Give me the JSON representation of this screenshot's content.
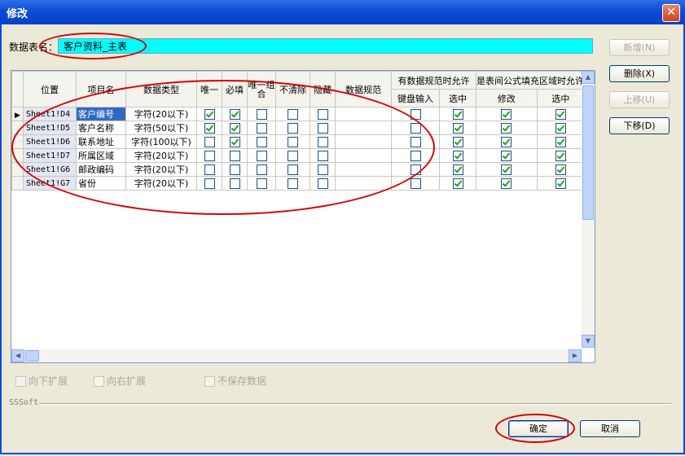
{
  "window": {
    "title": "修改",
    "close_icon": "close-icon"
  },
  "form": {
    "table_name_label": "数据表名：",
    "table_name_value": "客户资料_主表"
  },
  "buttons": {
    "add": "新增(N)",
    "delete": "删除(X)",
    "move_up": "上移(U)",
    "move_down": "下移(D)",
    "ok": "确定",
    "cancel": "取消"
  },
  "grid": {
    "headers": {
      "position": "位置",
      "item_name": "项目名",
      "data_type": "数据类型",
      "unique": "唯一",
      "required": "必填",
      "unique_combo": "唯一组合",
      "no_clear": "不清除",
      "hidden": "隐藏",
      "data_spec": "数据规范",
      "group1": "有数据规范时允许",
      "group2": "是表间公式填充区域时允许",
      "keyboard_input": "键盘输入",
      "select1": "选中",
      "modify": "修改",
      "select2": "选中"
    },
    "rows": [
      {
        "position": "Sheet1!D4",
        "name": "客户编号",
        "type": "字符(20以下)",
        "checks": [
          true,
          true,
          false,
          false,
          false,
          false,
          true,
          true,
          true
        ]
      },
      {
        "position": "Sheet1!D5",
        "name": "客户名称",
        "type": "字符(50以下)",
        "checks": [
          true,
          true,
          false,
          false,
          false,
          false,
          true,
          true,
          true
        ]
      },
      {
        "position": "Sheet1!D6",
        "name": "联系地址",
        "type": "字符(100以下)",
        "checks": [
          false,
          true,
          false,
          false,
          false,
          false,
          true,
          true,
          true
        ]
      },
      {
        "position": "Sheet1!D7",
        "name": "所属区域",
        "type": "字符(20以下)",
        "checks": [
          false,
          false,
          false,
          false,
          false,
          false,
          true,
          true,
          true
        ]
      },
      {
        "position": "Sheet1!G6",
        "name": "邮政编码",
        "type": "字符(20以下)",
        "checks": [
          false,
          false,
          false,
          false,
          false,
          false,
          true,
          true,
          true
        ]
      },
      {
        "position": "Sheet1!G7",
        "name": "省份",
        "type": "字符(20以下)",
        "checks": [
          false,
          false,
          false,
          false,
          false,
          false,
          true,
          true,
          true
        ]
      }
    ]
  },
  "options": {
    "expand_down": "向下扩展",
    "expand_right": "向右扩展",
    "no_save_data": "不保存数据"
  },
  "footer": {
    "brand": "SSSoft"
  },
  "colors": {
    "title_bar": "#0a4bd6",
    "table_name_bg": "#00ffff",
    "annotation": "#d40000",
    "check": "#21a121"
  }
}
